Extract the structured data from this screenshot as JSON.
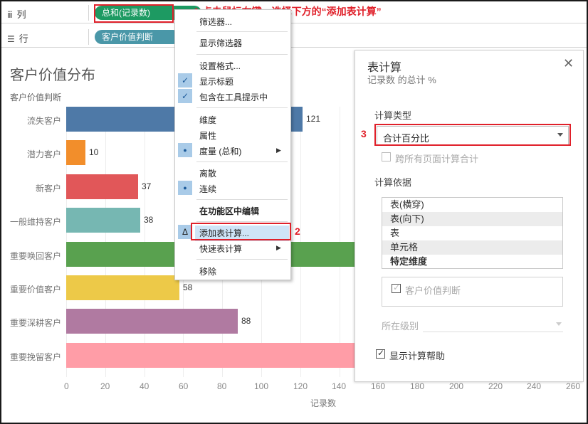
{
  "shelves": {
    "columns": {
      "label": "列",
      "pill": "总和(记录数)"
    },
    "rows": {
      "label": "行",
      "pill": "客户价值判断"
    }
  },
  "chart": {
    "title": "客户价值分布",
    "row_header": "客户价值判断",
    "xlabel": "记录数"
  },
  "chart_data": {
    "type": "bar",
    "orientation": "horizontal",
    "title": "客户价值分布",
    "ylabel": "客户价值判断",
    "xlabel": "记录数",
    "categories": [
      "流失客户",
      "潜力客户",
      "新客户",
      "一般维持客户",
      "重要唤回客户",
      "重要价值客户",
      "重要深耕客户",
      "重要挽留客户"
    ],
    "values": [
      121,
      10,
      37,
      38,
      null,
      58,
      88,
      null
    ],
    "value_labels": [
      "121",
      "10",
      "37",
      "38",
      "",
      "58",
      "88",
      ""
    ],
    "colors": [
      "#4e79a7",
      "#f28e2b",
      "#e15759",
      "#76b7b2",
      "#59a14f",
      "#edc948",
      "#b07aa1",
      "#ff9da7"
    ],
    "xticks": [
      "0",
      "20",
      "40",
      "60",
      "80",
      "100",
      "120",
      "140",
      "160",
      "180",
      "200",
      "220",
      "240",
      "260"
    ],
    "xlim": [
      0,
      262
    ],
    "grid": true
  },
  "menu": {
    "items": [
      {
        "label": "筛选器..."
      },
      {
        "label": "显示筛选器"
      },
      {
        "label": "设置格式..."
      },
      {
        "label": "显示标题",
        "checked": true
      },
      {
        "label": "包含在工具提示中",
        "checked": true
      },
      {
        "label": "维度"
      },
      {
        "label": "属性"
      },
      {
        "label": "度量 (总和)",
        "selected": true,
        "submenu": true
      },
      {
        "label": "离散"
      },
      {
        "label": "连续",
        "selected": true
      },
      {
        "label": "在功能区中编辑"
      },
      {
        "label": "添加表计算...",
        "delta": true
      },
      {
        "label": "快速表计算",
        "submenu": true
      },
      {
        "label": "移除"
      }
    ],
    "check_glyph": "✓",
    "dot_glyph": "●",
    "delta_glyph": "Δ",
    "arrow_glyph": "▶"
  },
  "annotations": {
    "step1": "1 点击鼠标右键，选择下方的“添加表计算”",
    "step2": "2",
    "step3": "3",
    "accent": "#e0202a"
  },
  "panel": {
    "title": "表计算",
    "subtitle": "记录数 的总计 %",
    "close_glyph": "✕",
    "calc_type_label": "计算类型",
    "calc_type_value": "合计百分比",
    "across_pages_label": "跨所有页面计算合计",
    "compute_using_label": "计算依据",
    "compute_using_options": [
      "表(横穿)",
      "表(向下)",
      "表",
      "单元格",
      "特定维度"
    ],
    "dimension_item": "客户价值判断",
    "at_level_label": "所在级别",
    "show_help_label": "显示计算帮助"
  }
}
